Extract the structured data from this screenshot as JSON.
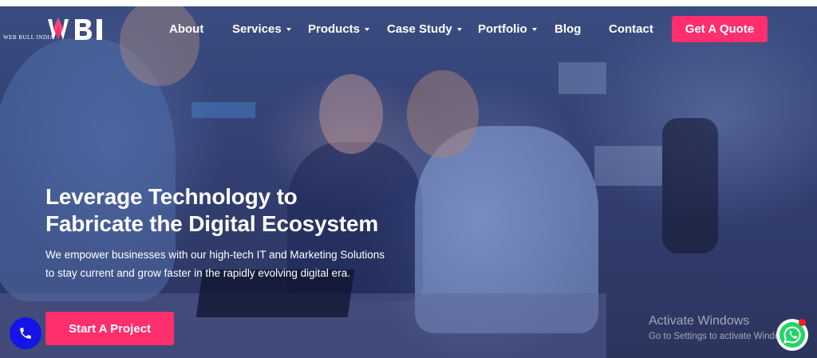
{
  "brand": {
    "logo_letters": "WBI",
    "name": "WEB BULL INDIA"
  },
  "nav": {
    "items": [
      {
        "label": "About",
        "has_dropdown": false
      },
      {
        "label": "Services",
        "has_dropdown": true
      },
      {
        "label": "Products",
        "has_dropdown": true
      },
      {
        "label": "Case Study",
        "has_dropdown": true
      },
      {
        "label": "Portfolio",
        "has_dropdown": true
      },
      {
        "label": "Blog",
        "has_dropdown": false
      },
      {
        "label": "Contact",
        "has_dropdown": false
      }
    ],
    "cta_label": "Get A Quote"
  },
  "hero": {
    "headline_line1": "Leverage Technology to",
    "headline_line2": "Fabricate the Digital Ecosystem",
    "subtext": "We empower businesses with our high-tech IT and Marketing Solutions to stay current and grow faster in the rapidly evolving digital era.",
    "cta_label": "Start A Project"
  },
  "watermark": {
    "line1": "Activate Windows",
    "line2": "Go to Settings to activate Windows."
  },
  "floating": {
    "phone_icon": "phone-icon",
    "whatsapp_icon": "whatsapp-icon"
  },
  "colors": {
    "accent": "#ff2e6c",
    "phone_button": "#1414e8",
    "whatsapp": "#25d366",
    "overlay": "#333f72"
  }
}
